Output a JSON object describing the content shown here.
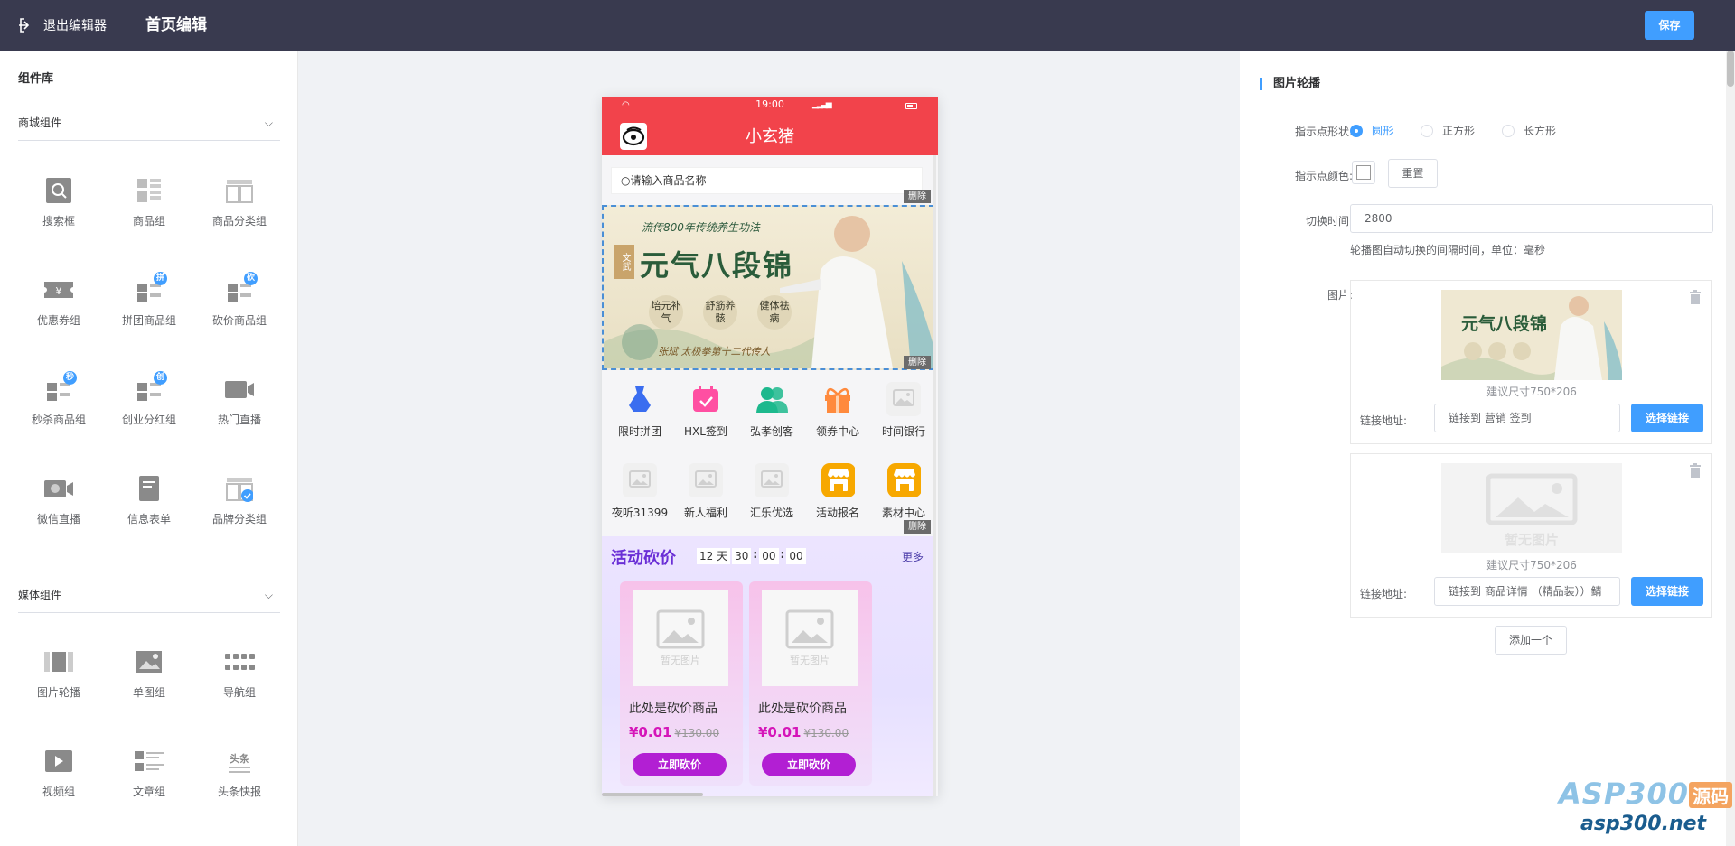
{
  "topbar": {
    "exit_label": "退出编辑器",
    "page_title": "首页编辑",
    "save_label": "保存"
  },
  "library": {
    "title": "组件库",
    "groups": [
      {
        "name": "商城组件",
        "items": [
          {
            "label": "搜索框",
            "icon": "search-icon"
          },
          {
            "label": "商品组",
            "icon": "goods-grid-icon"
          },
          {
            "label": "商品分类组",
            "icon": "category-grid-icon"
          },
          {
            "label": "优惠券组",
            "icon": "coupon-icon"
          },
          {
            "label": "拼团商品组",
            "icon": "group-buy-icon",
            "badge": "拼"
          },
          {
            "label": "砍价商品组",
            "icon": "bargain-icon",
            "badge": "砍"
          },
          {
            "label": "秒杀商品组",
            "icon": "flash-sale-icon",
            "badge": "秒"
          },
          {
            "label": "创业分红组",
            "icon": "dividend-icon",
            "badge": "创"
          },
          {
            "label": "热门直播",
            "icon": "live-camera-icon"
          },
          {
            "label": "微信直播",
            "icon": "wechat-live-icon"
          },
          {
            "label": "信息表单",
            "icon": "form-icon"
          },
          {
            "label": "品牌分类组",
            "icon": "brand-category-icon"
          }
        ]
      },
      {
        "name": "媒体组件",
        "items": [
          {
            "label": "图片轮播",
            "icon": "carousel-icon"
          },
          {
            "label": "单图组",
            "icon": "single-image-icon"
          },
          {
            "label": "导航组",
            "icon": "navigation-icon"
          },
          {
            "label": "视频组",
            "icon": "video-icon"
          },
          {
            "label": "文章组",
            "icon": "article-icon"
          },
          {
            "label": "头条快报",
            "icon": "headline-icon"
          }
        ]
      }
    ]
  },
  "phone": {
    "time": "19:00",
    "shop_name": "小玄猪",
    "search_placeholder": "请输入商品名称",
    "delete_label": "删除",
    "banner": {
      "top_line": "流传800年传统养生功法",
      "title": "元气八段锦",
      "seal": "文武",
      "b1": "培元补气",
      "b2": "舒筋养骸",
      "b3": "健体祛病",
      "footer": "张斌 太极拳第十二代传人"
    },
    "nav_items": [
      {
        "label": "限时拼团",
        "icon": "vase-icon",
        "color": "#3a6df0"
      },
      {
        "label": "HXL签到",
        "icon": "calendar-check-icon",
        "color": "#ff4fa2"
      },
      {
        "label": "弘孝创客",
        "icon": "users-icon",
        "color": "#1db88d"
      },
      {
        "label": "领券中心",
        "icon": "gift-icon",
        "color": "#ff8a3d"
      },
      {
        "label": "时间银行",
        "icon": "image-placeholder-icon",
        "color": "#d0d0d0"
      },
      {
        "label": "夜听31399",
        "icon": "image-placeholder-icon",
        "color": "#d0d0d0"
      },
      {
        "label": "新人福利",
        "icon": "image-placeholder-icon",
        "color": "#d0d0d0"
      },
      {
        "label": "汇乐优选",
        "icon": "image-placeholder-icon",
        "color": "#d0d0d0"
      },
      {
        "label": "活动报名",
        "icon": "storefront-icon",
        "color": "#f7a800"
      },
      {
        "label": "素材中心",
        "icon": "storefront-icon",
        "color": "#f7a800"
      }
    ],
    "bargain": {
      "title": "活动砍价",
      "countdown": {
        "days": "12",
        "day_unit": "天",
        "h": "30",
        "m": "00",
        "s": "00",
        "sep": ":"
      },
      "more": "更多",
      "no_image": "暂无图片",
      "products": [
        {
          "name": "此处是砍价商品",
          "price": "¥0.01",
          "old_price": "¥130.00",
          "button": "立即砍价"
        },
        {
          "name": "此处是砍价商品",
          "price": "¥0.01",
          "old_price": "¥130.00",
          "button": "立即砍价"
        }
      ]
    }
  },
  "settings": {
    "title": "图片轮播",
    "dot_shape_label": "指示点形状:",
    "dot_shapes": [
      {
        "label": "圆形",
        "selected": true
      },
      {
        "label": "正方形",
        "selected": false
      },
      {
        "label": "长方形",
        "selected": false
      }
    ],
    "dot_color_label": "指示点颜色:",
    "dot_color": "#ffffff",
    "reset_label": "重置",
    "interval_label": "切换时间:",
    "interval_value": "2800",
    "interval_hint": "轮播图自动切换的间隔时间，单位：毫秒",
    "images_label": "图片:",
    "no_image": "暂无图片",
    "images": [
      {
        "size_hint": "建议尺寸750*206",
        "link_label": "链接地址:",
        "link_value": "链接到 营销 签到",
        "choose_label": "选择链接",
        "has_image": true
      },
      {
        "size_hint": "建议尺寸750*206",
        "link_label": "链接地址:",
        "link_value": "链接到 商品详情 （精品装））鲭",
        "choose_label": "选择链接",
        "has_image": false
      }
    ],
    "add_label": "添加一个"
  },
  "watermark": {
    "brand": "ASP300",
    "tag": "源码",
    "url": "asp300.net"
  }
}
